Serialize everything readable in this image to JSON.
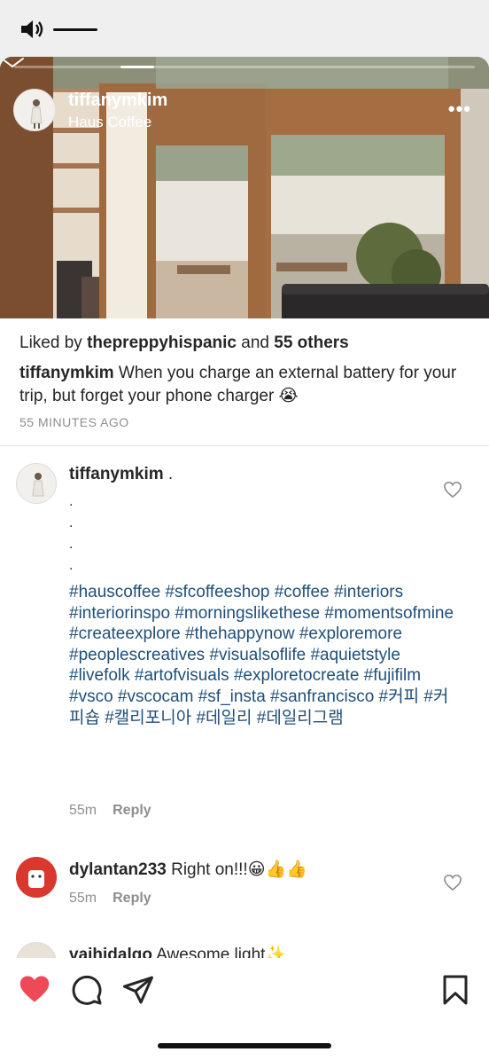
{
  "post": {
    "username": "tiffanymkim",
    "location": "Haus Coffee",
    "liked_prefix": "Liked by",
    "liked_user": "thepreppyhispanic",
    "liked_and": "and",
    "liked_others": "55 others",
    "caption_user": "tiffanymkim",
    "caption_text": "When you charge an external battery for your trip, but forget your phone charger 😭",
    "time_ago": "55 MINUTES AGO"
  },
  "comments": [
    {
      "username": "tiffanymkim",
      "text": ".",
      "dots": [
        ".",
        ".",
        ".",
        "."
      ],
      "hashtags": "#hauscoffee #sfcoffeeshop #coffee #interiors #interiorinspo #morningslikethese #momentsofmine #createexplore #thehappynow #exploremore #peoplescreatives #visualsoflife #aquietstyle #livefolk #artofvisuals #exploretocreate #fujifilm #vsco #vscocam #sf_insta #sanfrancisco #커피 #커피숍 #캘리포니아 #데일리 #데일리그램",
      "age": "55m",
      "reply": "Reply"
    },
    {
      "username": "dylantan233",
      "text": "Right on!!!😀👍👍",
      "age": "55m",
      "reply": "Reply"
    },
    {
      "username": "vaihidalgo",
      "text": "Awesome light✨"
    }
  ],
  "colors": {
    "like_red": "#ed4956",
    "hashtag_blue": "#1f4f7a"
  }
}
